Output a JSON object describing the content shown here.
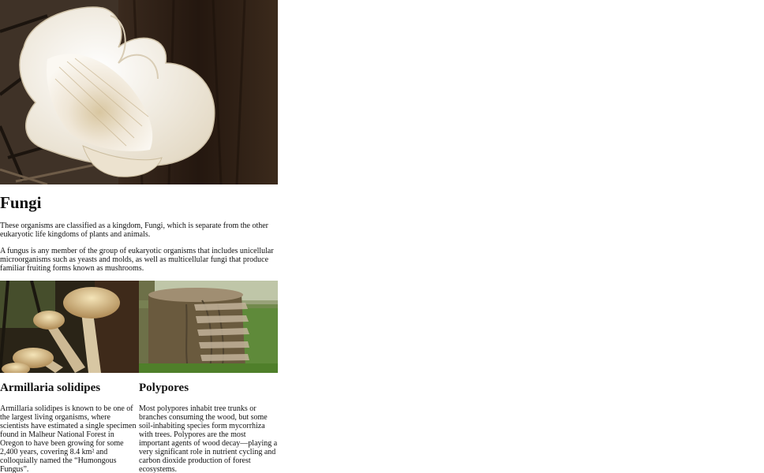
{
  "hero": {
    "alt": "White oyster-like fungus growing against dark tree bark"
  },
  "main": {
    "title": "Fungi",
    "paragraphs": [
      "These organisms are classified as a kingdom, Fungi, which is separate from the other eukaryotic life kingdoms of plants and animals.",
      "A fungus is any member of the group of eukaryotic organisms that includes unicellular microorganisms such as yeasts and molds, as well as multicellular fungi that produce familiar fruiting forms known as mushrooms."
    ]
  },
  "cards": [
    {
      "title": "Armillaria solidipes",
      "text": "Armillaria solidipes is known to be one of the largest living organisms, where scientists have estimated a single specimen found in Malheur National Forest in Oregon to have been growing for some 2,400 years, covering 8.4 km² and colloquially named the “Humongous Fungus”."
    },
    {
      "title": "Polypores",
      "text": "Most polypores inhabit tree trunks or branches consuming the wood, but some soil-inhabiting species form mycorrhiza with trees. Polypores are the most important agents of wood decay—playing a very significant role in nutrient cycling and carbon dioxide production of forest ecosystems."
    }
  ]
}
